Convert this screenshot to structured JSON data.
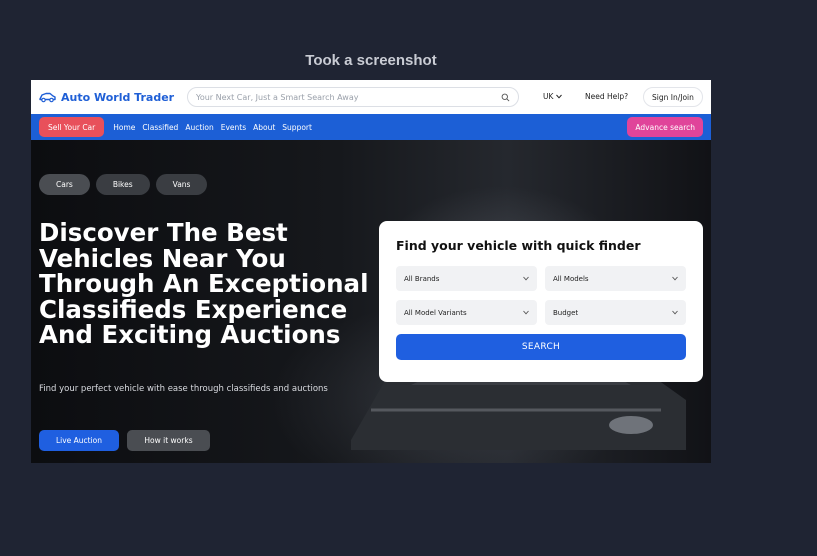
{
  "caption": "Took a screenshot",
  "header": {
    "brand": "Auto World Trader",
    "search_placeholder": "Your Next Car, Just a Smart Search Away",
    "region": "UK",
    "help": "Need Help?",
    "signin": "Sign In/Join"
  },
  "nav": {
    "sell": "Sell Your Car",
    "links": [
      "Home",
      "Classified",
      "Auction",
      "Events",
      "About",
      "Support"
    ],
    "advance": "Advance search"
  },
  "hero": {
    "tabs": [
      "Cars",
      "Bikes",
      "Vans"
    ],
    "title": "Discover The Best Vehicles Near You Through An Exceptional Classifieds Experience And Exciting Auctions",
    "subtitle": "Find your perfect vehicle with ease through classifieds and auctions",
    "live_button": "Live Auction",
    "how_button": "How it works"
  },
  "finder": {
    "title": "Find your vehicle with quick finder",
    "brands": "All Brands",
    "models": "All Models",
    "variants": "All Model Variants",
    "budget": "Budget",
    "search": "SEARCH"
  },
  "colors": {
    "brand_blue": "#1c5fd6",
    "sell_red": "#e8505b",
    "advance_pink": "#e0449a",
    "page_bg": "#1f2433"
  },
  "icons": [
    "car-logo-icon",
    "search-icon",
    "chevron-down-icon"
  ]
}
